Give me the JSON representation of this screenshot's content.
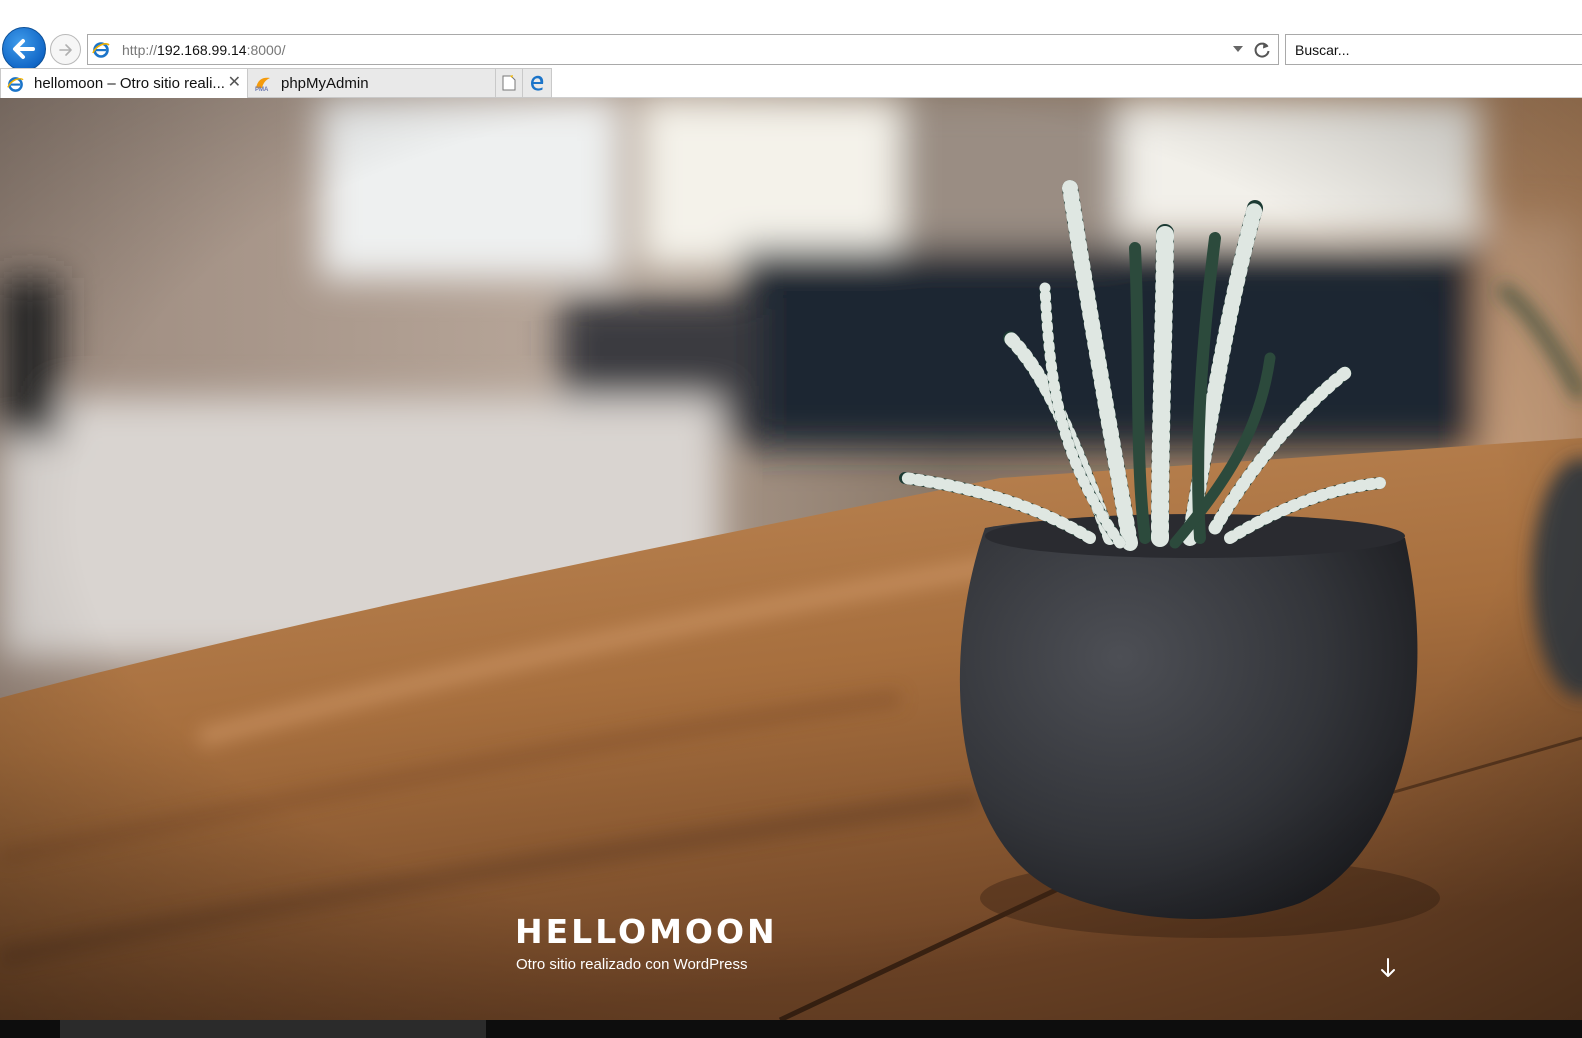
{
  "browser": {
    "address": {
      "scheme": "http://",
      "host": "192.168.99.14",
      "port_path": ":8000/"
    },
    "search": {
      "placeholder": "Buscar..."
    },
    "tabs": [
      {
        "label": "hellomoon – Otro sitio reali...",
        "active": true,
        "icon": "ie-page-icon"
      },
      {
        "label": "phpMyAdmin",
        "active": false,
        "icon": "phpmyadmin-icon"
      }
    ],
    "icons": [
      "back-arrow-icon",
      "forward-arrow-icon",
      "dropdown-arrow-icon",
      "refresh-icon",
      "close-icon",
      "new-tab-icon",
      "edge-icon"
    ],
    "accent_color": "#1167c7"
  },
  "page": {
    "site_title": "HELLOMOON",
    "tagline": "Otro sitio realizado con WordPress",
    "scroll_icon": "arrow-down-icon"
  }
}
